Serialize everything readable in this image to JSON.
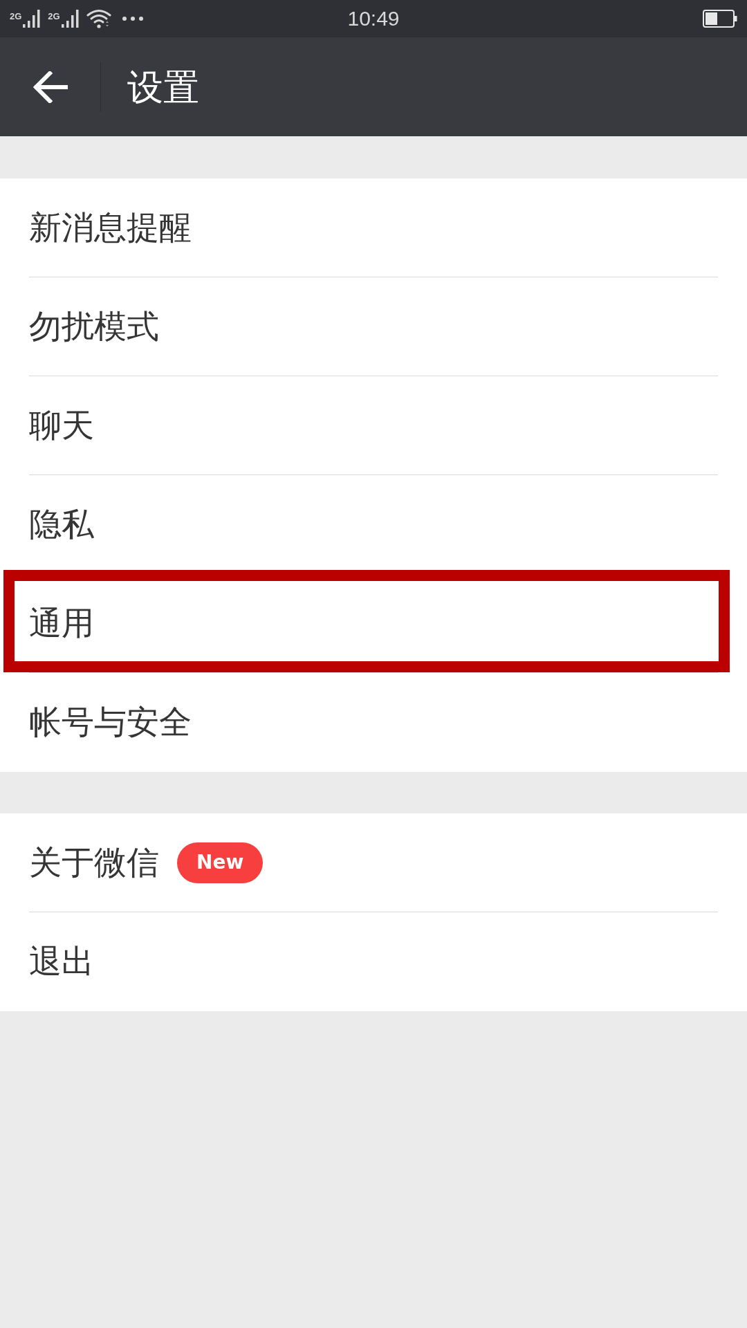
{
  "status_bar": {
    "signals": [
      {
        "label": "2G"
      },
      {
        "label": "2G"
      }
    ],
    "time": "10:49"
  },
  "header": {
    "title": "设置"
  },
  "groups": [
    {
      "items": [
        {
          "label": "新消息提醒",
          "highlighted": false
        },
        {
          "label": "勿扰模式",
          "highlighted": false
        },
        {
          "label": "聊天",
          "highlighted": false
        },
        {
          "label": "隐私",
          "highlighted": false
        },
        {
          "label": "通用",
          "highlighted": true
        },
        {
          "label": "帐号与安全",
          "highlighted": false
        }
      ]
    },
    {
      "items": [
        {
          "label": "关于微信",
          "badge": "New",
          "highlighted": false
        },
        {
          "label": "退出",
          "highlighted": false
        }
      ]
    }
  ]
}
